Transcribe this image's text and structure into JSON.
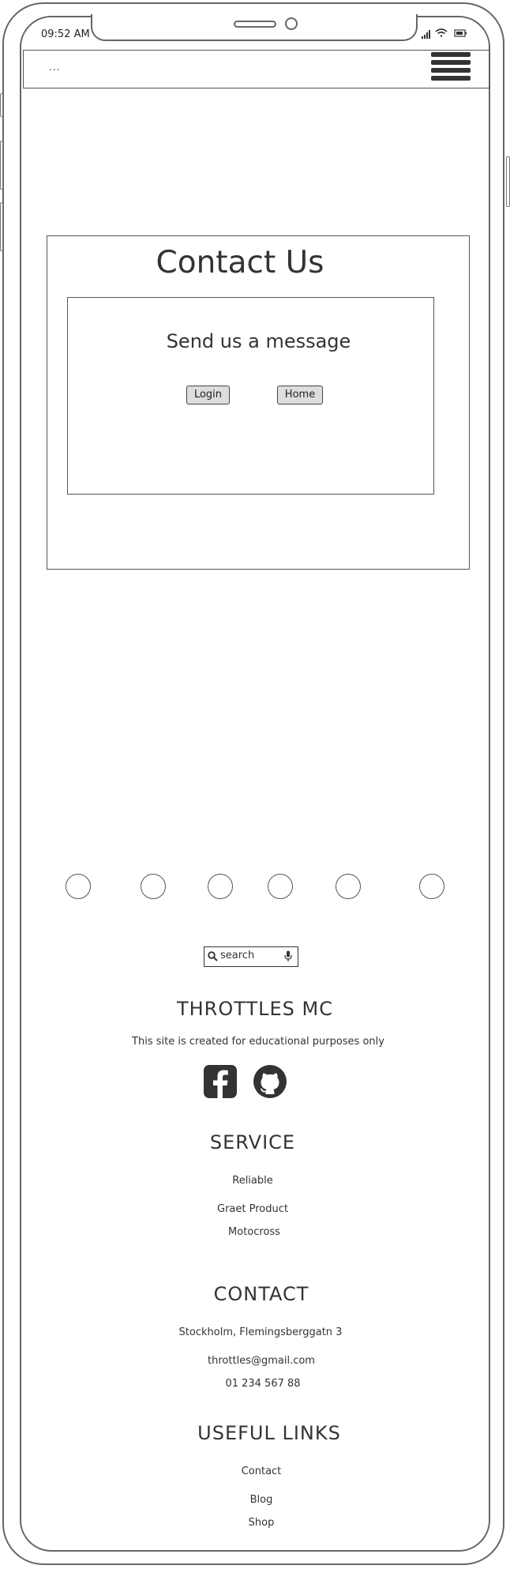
{
  "status_bar": {
    "time": "09:52 AM"
  },
  "navbar": {
    "brand": "..."
  },
  "contact": {
    "title": "Contact Us",
    "panel_title": "Send us a message",
    "login_button": "Login",
    "home_button": "Home"
  },
  "search": {
    "placeholder": "search"
  },
  "footer": {
    "site_name": "THROTTLES MC",
    "disclaimer": "This site is created for educational purposes only",
    "service": {
      "heading": "SERVICE",
      "items": [
        "Reliable",
        "Graet Product",
        "Motocross"
      ]
    },
    "contact": {
      "heading": "CONTACT",
      "address": "Stockholm, Flemingsberggatn 3",
      "email": "throttles@gmail.com",
      "phone": "01 234 567 88"
    },
    "links": {
      "heading": "USEFUL LINKS",
      "items": [
        "Contact",
        "Blog",
        "Shop"
      ]
    }
  },
  "colors": {
    "stroke": "#555555",
    "button_bg": "#dddddd",
    "text": "#333333"
  }
}
